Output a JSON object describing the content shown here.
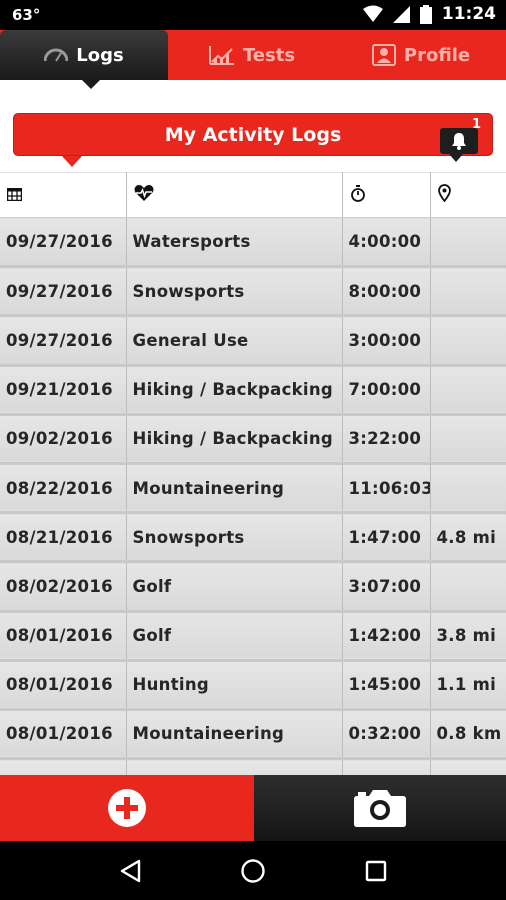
{
  "status_bar": {
    "temperature": "63°",
    "time": "11:24"
  },
  "tabs": [
    {
      "label": "Logs",
      "icon": "gauge-icon"
    },
    {
      "label": "Tests",
      "icon": "chart-icon"
    },
    {
      "label": "Profile",
      "icon": "profile-card-icon"
    }
  ],
  "banner": {
    "title": "My Activity Logs",
    "notification_count": "1"
  },
  "table": {
    "header_icons": [
      "calendar-table-icon",
      "heart-rate-icon",
      "stopwatch-icon",
      "location-pin-icon"
    ],
    "rows": [
      [
        "09/27/2016",
        "Watersports",
        "4:00:00",
        ""
      ],
      [
        "09/27/2016",
        "Snowsports",
        "8:00:00",
        ""
      ],
      [
        "09/27/2016",
        "General Use",
        "3:00:00",
        ""
      ],
      [
        "09/21/2016",
        "Hiking / Backpacking",
        "7:00:00",
        ""
      ],
      [
        "09/02/2016",
        "Hiking / Backpacking",
        "3:22:00",
        ""
      ],
      [
        "08/22/2016",
        "Mountaineering",
        "11:06:03",
        ""
      ],
      [
        "08/21/2016",
        "Snowsports",
        "1:47:00",
        "4.8 mi"
      ],
      [
        "08/02/2016",
        "Golf",
        "3:07:00",
        ""
      ],
      [
        "08/01/2016",
        "Golf",
        "1:42:00",
        "3.8 mi"
      ],
      [
        "08/01/2016",
        "Hunting",
        "1:45:00",
        "1.1 mi"
      ],
      [
        "08/01/2016",
        "Mountaineering",
        "0:32:00",
        "0.8 km"
      ],
      [
        "",
        "",
        "",
        ""
      ]
    ]
  },
  "bottom_bar": {
    "add_icon": "add-circle-icon",
    "camera_icon": "camera-icon"
  },
  "colors": {
    "accent": "#e8281e",
    "dark": "#1b1b1b"
  }
}
